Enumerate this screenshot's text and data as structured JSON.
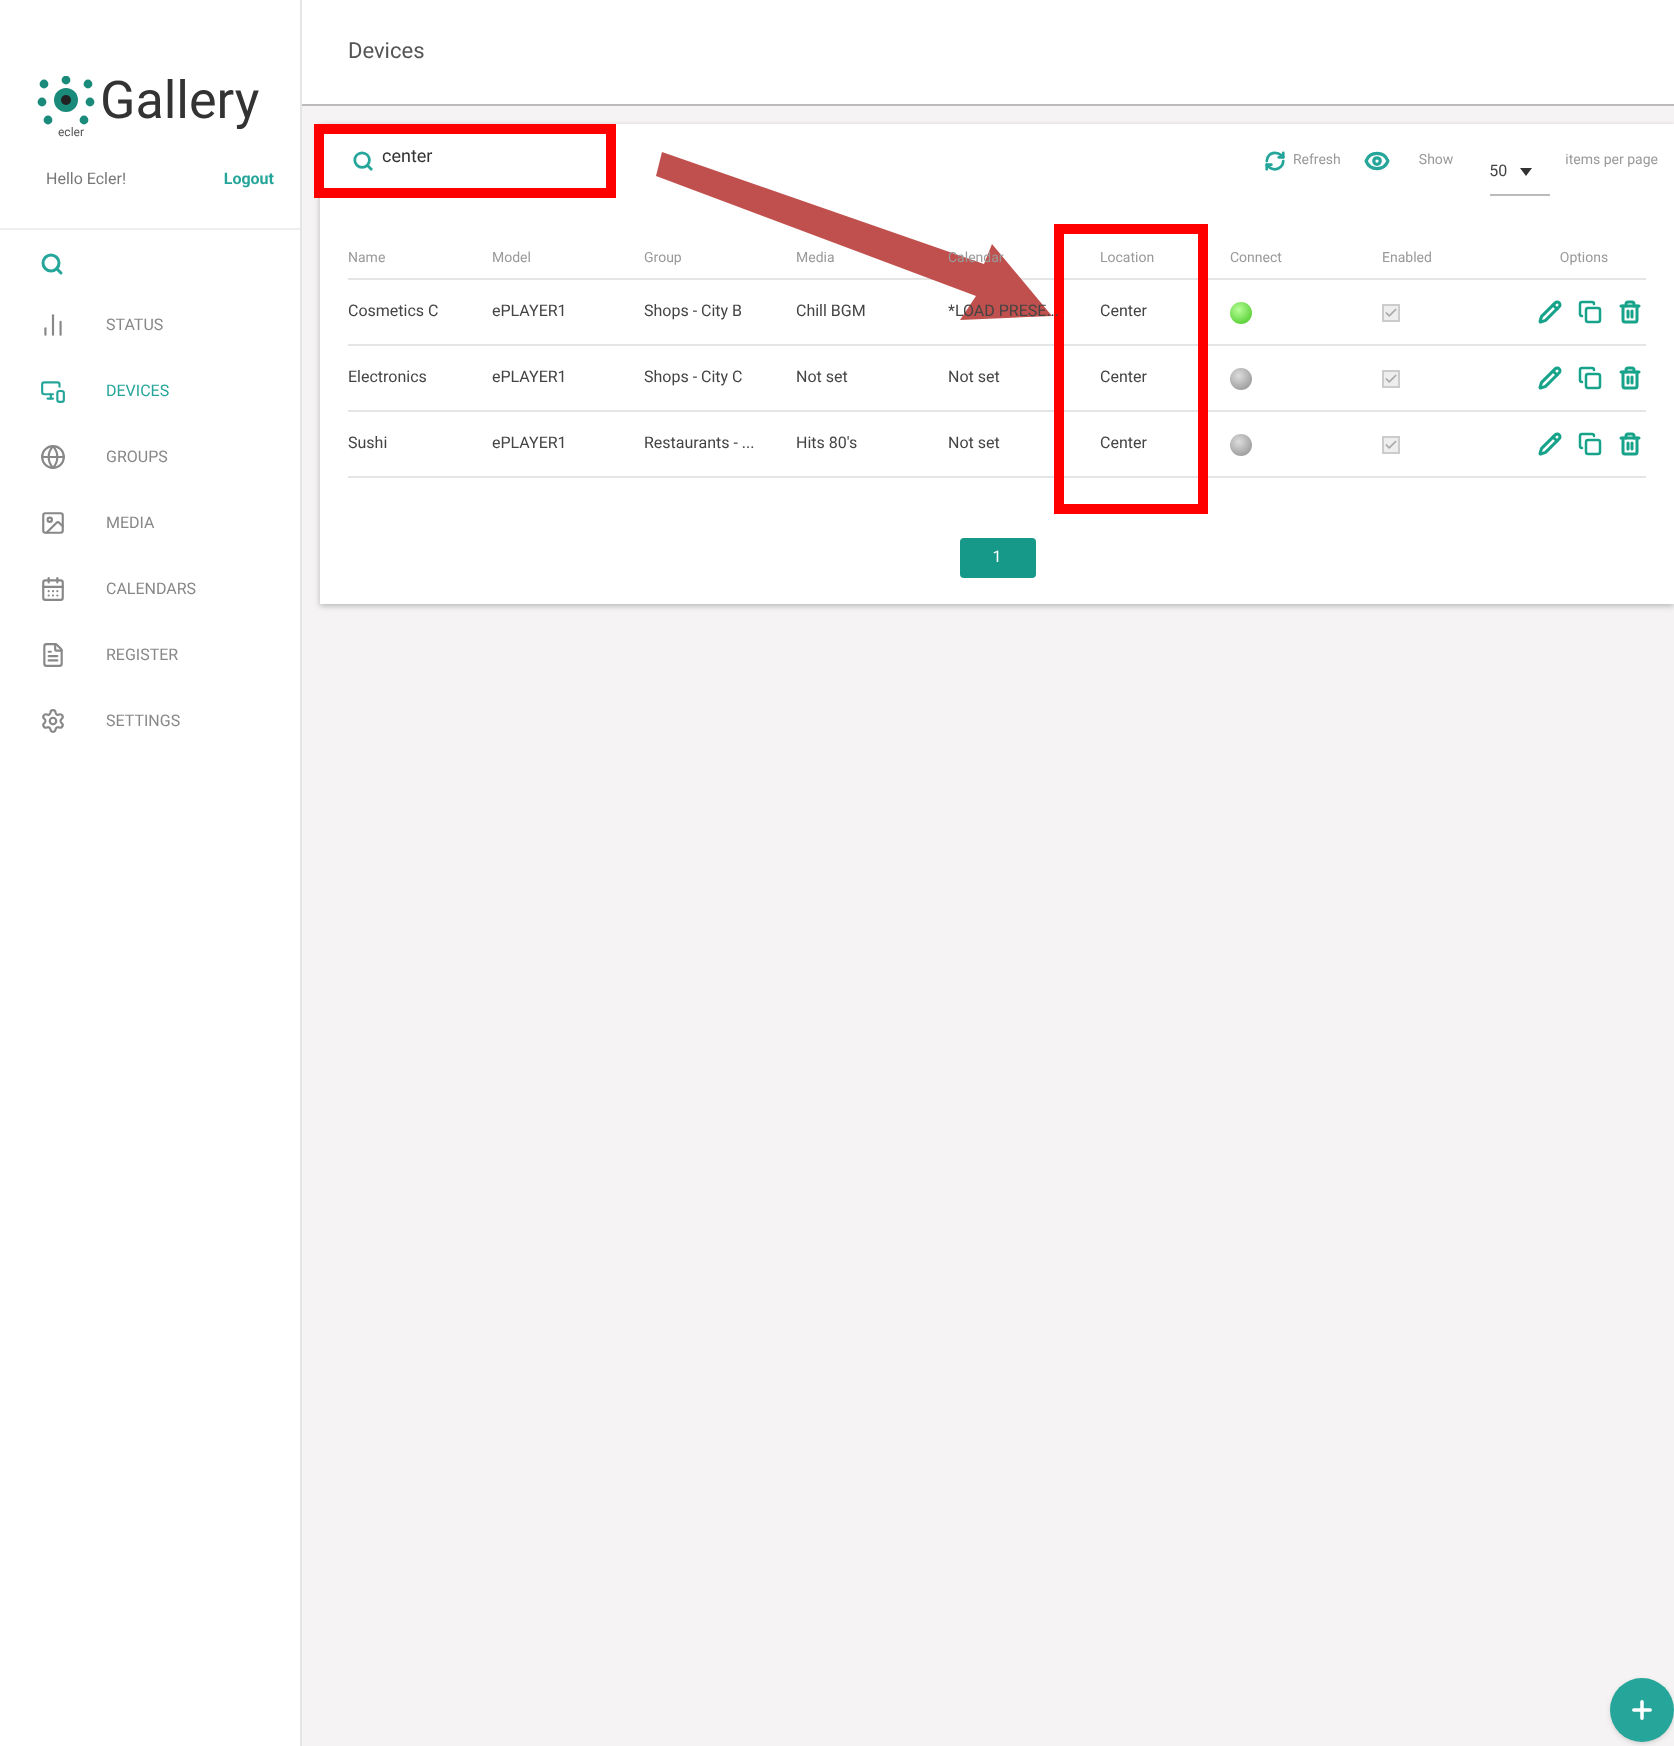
{
  "brand": {
    "name": "Gallery",
    "sub": "ecler"
  },
  "user": {
    "greeting": "Hello Ecler!",
    "logout": "Logout"
  },
  "sidebar": {
    "items": [
      {
        "kind": "search",
        "selected": false
      },
      {
        "kind": "status",
        "label": "STATUS",
        "selected": false
      },
      {
        "kind": "devices",
        "label": "DEVICES",
        "selected": true
      },
      {
        "kind": "groups",
        "label": "GROUPS",
        "selected": false
      },
      {
        "kind": "media",
        "label": "MEDIA",
        "selected": false
      },
      {
        "kind": "calendars",
        "label": "CALENDARS",
        "selected": false
      },
      {
        "kind": "register",
        "label": "REGISTER",
        "selected": false
      },
      {
        "kind": "settings",
        "label": "SETTINGS",
        "selected": false
      }
    ]
  },
  "page_title": "Devices",
  "toolbar": {
    "search": "center",
    "refresh": "Refresh",
    "show": "Show",
    "per_page": "50",
    "per_page_label": "items per page"
  },
  "table": {
    "columns": [
      "Name",
      "Model",
      "Group",
      "Media",
      "Calendar",
      "Location",
      "Connect",
      "Enabled",
      "Options"
    ],
    "rows": [
      {
        "name": "Cosmetics C",
        "model": "ePLAYER1",
        "group": "Shops - City B",
        "media": "Chill BGM",
        "calendar": "*LOAD PRESE...",
        "location": "Center",
        "connected": true,
        "enabled": true
      },
      {
        "name": "Electronics",
        "model": "ePLAYER1",
        "group": "Shops - City C",
        "media": "Not set",
        "calendar": "Not set",
        "location": "Center",
        "connected": false,
        "enabled": true
      },
      {
        "name": "Sushi",
        "model": "ePLAYER1",
        "group": "Restaurants - ...",
        "media": "Hits 80's",
        "calendar": "Not set",
        "location": "Center",
        "connected": false,
        "enabled": true
      }
    ]
  },
  "pagination": [
    {
      "label": "1",
      "selected": true
    }
  ]
}
